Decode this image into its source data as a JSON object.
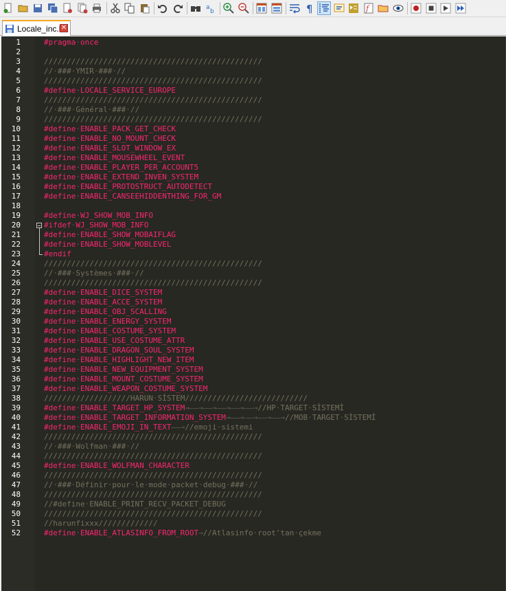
{
  "toolbar": {
    "buttons": [
      {
        "icon": "new-file-icon",
        "color": "#3c8a2e"
      },
      {
        "icon": "open-file-icon",
        "color": "#e0b040"
      },
      {
        "icon": "save-icon",
        "color": "#4a6fb0"
      },
      {
        "icon": "save-all-icon",
        "color": "#4a6fb0"
      },
      {
        "icon": "close-icon",
        "color": "#c04040"
      },
      {
        "icon": "close-all-icon",
        "color": "#c04040"
      },
      {
        "icon": "print-icon",
        "color": "#606060"
      },
      {
        "sep": true
      },
      {
        "icon": "cut-icon",
        "color": "#505050"
      },
      {
        "icon": "copy-icon",
        "color": "#505050"
      },
      {
        "icon": "paste-icon",
        "color": "#8a6a30"
      },
      {
        "sep": true
      },
      {
        "icon": "undo-icon",
        "color": "#404040"
      },
      {
        "icon": "redo-icon",
        "color": "#404040"
      },
      {
        "sep": true
      },
      {
        "icon": "find-icon",
        "color": "#404040"
      },
      {
        "icon": "replace-icon",
        "color": "#2a6fc0"
      },
      {
        "sep": true
      },
      {
        "icon": "zoom-in-icon",
        "color": "#2a8a40"
      },
      {
        "icon": "zoom-out-icon",
        "color": "#c04040"
      },
      {
        "sep": true
      },
      {
        "icon": "sync-vertical-icon",
        "color": "#c05020"
      },
      {
        "icon": "sync-horizontal-icon",
        "color": "#c05020"
      },
      {
        "sep": true
      },
      {
        "icon": "word-wrap-icon",
        "color": "#2a5fb0"
      },
      {
        "icon": "show-all-chars-icon",
        "color": "#2a5fb0"
      },
      {
        "icon": "indent-guide-icon",
        "color": "#2a5fb0",
        "active": true
      },
      {
        "icon": "user-language-icon",
        "color": "#d09030"
      },
      {
        "icon": "document-map-icon",
        "color": "#c0a030"
      },
      {
        "icon": "function-list-icon",
        "color": "#c04040"
      },
      {
        "icon": "folder-workspace-icon",
        "color": "#c04040"
      },
      {
        "icon": "monitoring-icon",
        "color": "#404040"
      },
      {
        "sep": true
      },
      {
        "icon": "record-macro-icon",
        "color": "#c02020"
      },
      {
        "icon": "stop-record-icon",
        "color": "#404040"
      },
      {
        "icon": "playback-macro-icon",
        "color": "#404040"
      },
      {
        "icon": "run-macro-multiple-icon",
        "color": "#2a5fb0"
      }
    ]
  },
  "tab": {
    "label": "Locale_inc.h",
    "close": "✕"
  },
  "colors": {
    "bg": "#272822",
    "keyword": "#f92672",
    "comment": "#75715e",
    "whitespace": "#5f5f56",
    "line_number": "#ffffff"
  },
  "lines": [
    {
      "n": "1",
      "parts": [
        [
          "kw",
          "#pragma"
        ],
        [
          "ws",
          "·"
        ],
        [
          "id",
          "once"
        ]
      ]
    },
    {
      "n": "2",
      "parts": []
    },
    {
      "n": "3",
      "parts": [
        [
          "cm",
          "////////////////////////////////////////////////"
        ]
      ]
    },
    {
      "n": "4",
      "parts": [
        [
          "cm",
          "//"
        ],
        [
          "ws",
          "·"
        ],
        [
          "cm",
          "###"
        ],
        [
          "ws",
          "·"
        ],
        [
          "cm",
          "YMIR"
        ],
        [
          "ws",
          "·"
        ],
        [
          "cm",
          "###"
        ],
        [
          "ws",
          "·"
        ],
        [
          "cm",
          "//"
        ]
      ]
    },
    {
      "n": "5",
      "parts": [
        [
          "cm",
          "////////////////////////////////////////////////"
        ]
      ]
    },
    {
      "n": "6",
      "parts": [
        [
          "kw",
          "#define"
        ],
        [
          "ws",
          "·"
        ],
        [
          "id",
          "LOCALE_SERVICE_EUROPE"
        ]
      ]
    },
    {
      "n": "7",
      "parts": [
        [
          "cm",
          "////////////////////////////////////////////////"
        ]
      ]
    },
    {
      "n": "8",
      "parts": [
        [
          "cm",
          "//"
        ],
        [
          "ws",
          "·"
        ],
        [
          "cm",
          "###"
        ],
        [
          "ws",
          "·"
        ],
        [
          "cm",
          "Général"
        ],
        [
          "ws",
          "·"
        ],
        [
          "cm",
          "###"
        ],
        [
          "ws",
          "·"
        ],
        [
          "cm",
          "//"
        ]
      ]
    },
    {
      "n": "9",
      "parts": [
        [
          "cm",
          "////////////////////////////////////////////////"
        ]
      ]
    },
    {
      "n": "10",
      "parts": [
        [
          "kw",
          "#define"
        ],
        [
          "ws",
          "·"
        ],
        [
          "id",
          "ENABLE_PACK_GET_CHECK"
        ]
      ]
    },
    {
      "n": "11",
      "parts": [
        [
          "kw",
          "#define"
        ],
        [
          "ws",
          "·"
        ],
        [
          "id",
          "ENABLE_NO_MOUNT_CHECK"
        ]
      ]
    },
    {
      "n": "12",
      "parts": [
        [
          "kw",
          "#define"
        ],
        [
          "ws",
          "·"
        ],
        [
          "id",
          "ENABLE_SLOT_WINDOW_EX"
        ]
      ]
    },
    {
      "n": "13",
      "parts": [
        [
          "kw",
          "#define"
        ],
        [
          "ws",
          "·"
        ],
        [
          "id",
          "ENABLE_MOUSEWHEEL_EVENT"
        ]
      ]
    },
    {
      "n": "14",
      "parts": [
        [
          "kw",
          "#define"
        ],
        [
          "ws",
          "·"
        ],
        [
          "id",
          "ENABLE_PLAYER_PER_ACCOUNT5"
        ]
      ]
    },
    {
      "n": "15",
      "parts": [
        [
          "kw",
          "#define"
        ],
        [
          "ws",
          "·"
        ],
        [
          "id",
          "ENABLE_EXTEND_INVEN_SYSTEM"
        ]
      ]
    },
    {
      "n": "16",
      "parts": [
        [
          "kw",
          "#define"
        ],
        [
          "ws",
          "·"
        ],
        [
          "id",
          "ENABLE_PROTOSTRUCT_AUTODETECT"
        ]
      ]
    },
    {
      "n": "17",
      "parts": [
        [
          "kw",
          "#define"
        ],
        [
          "ws",
          "·"
        ],
        [
          "id",
          "ENABLE_CANSEEHIDDENTHING_FOR_GM"
        ]
      ]
    },
    {
      "n": "18",
      "parts": []
    },
    {
      "n": "19",
      "parts": [
        [
          "kw",
          "#define"
        ],
        [
          "ws",
          "·"
        ],
        [
          "id",
          "WJ_SHOW_MOB_INFO"
        ]
      ]
    },
    {
      "n": "20",
      "parts": [
        [
          "kw",
          "#ifdef"
        ],
        [
          "ws",
          "·"
        ],
        [
          "id",
          "WJ_SHOW_MOB_INFO"
        ]
      ],
      "fold": "start"
    },
    {
      "n": "21",
      "parts": [
        [
          "kw",
          "#define"
        ],
        [
          "ws",
          "·"
        ],
        [
          "id",
          "ENABLE_SHOW_MOBAIFLAG"
        ]
      ],
      "fold": "mid"
    },
    {
      "n": "22",
      "parts": [
        [
          "kw",
          "#define"
        ],
        [
          "ws",
          "·"
        ],
        [
          "id",
          "ENABLE_SHOW_MOBLEVEL"
        ]
      ],
      "fold": "mid"
    },
    {
      "n": "23",
      "parts": [
        [
          "kw",
          "#endif"
        ]
      ],
      "fold": "end"
    },
    {
      "n": "24",
      "parts": [
        [
          "cm",
          "////////////////////////////////////////////////"
        ]
      ]
    },
    {
      "n": "25",
      "parts": [
        [
          "cm",
          "//"
        ],
        [
          "ws",
          "·"
        ],
        [
          "cm",
          "###"
        ],
        [
          "ws",
          "·"
        ],
        [
          "cm",
          "Systèmes"
        ],
        [
          "ws",
          "·"
        ],
        [
          "cm",
          "###"
        ],
        [
          "ws",
          "·"
        ],
        [
          "cm",
          "//"
        ]
      ]
    },
    {
      "n": "26",
      "parts": [
        [
          "cm",
          "////////////////////////////////////////////////"
        ]
      ]
    },
    {
      "n": "27",
      "parts": [
        [
          "kw",
          "#define"
        ],
        [
          "ws",
          "·"
        ],
        [
          "id",
          "ENABLE_DICE_SYSTEM"
        ]
      ]
    },
    {
      "n": "28",
      "parts": [
        [
          "kw",
          "#define"
        ],
        [
          "ws",
          "·"
        ],
        [
          "id",
          "ENABLE_ACCE_SYSTEM"
        ]
      ]
    },
    {
      "n": "29",
      "parts": [
        [
          "kw",
          "#define"
        ],
        [
          "ws",
          "·"
        ],
        [
          "id",
          "ENABLE_OBJ_SCALLING"
        ]
      ]
    },
    {
      "n": "30",
      "parts": [
        [
          "kw",
          "#define"
        ],
        [
          "ws",
          "·"
        ],
        [
          "id",
          "ENABLE_ENERGY_SYSTEM"
        ]
      ]
    },
    {
      "n": "31",
      "parts": [
        [
          "kw",
          "#define"
        ],
        [
          "ws",
          "·"
        ],
        [
          "id",
          "ENABLE_COSTUME_SYSTEM"
        ]
      ]
    },
    {
      "n": "32",
      "parts": [
        [
          "kw",
          "#define"
        ],
        [
          "ws",
          "·"
        ],
        [
          "id",
          "ENABLE_USE_COSTUME_ATTR"
        ]
      ]
    },
    {
      "n": "33",
      "parts": [
        [
          "kw",
          "#define"
        ],
        [
          "ws",
          "·"
        ],
        [
          "id",
          "ENABLE_DRAGON_SOUL_SYSTEM"
        ]
      ]
    },
    {
      "n": "34",
      "parts": [
        [
          "kw",
          "#define"
        ],
        [
          "ws",
          "·"
        ],
        [
          "id",
          "ENABLE_HIGHLIGHT_NEW_ITEM"
        ]
      ]
    },
    {
      "n": "35",
      "parts": [
        [
          "kw",
          "#define"
        ],
        [
          "ws",
          "·"
        ],
        [
          "id",
          "ENABLE_NEW_EQUIPMENT_SYSTEM"
        ]
      ]
    },
    {
      "n": "36",
      "parts": [
        [
          "kw",
          "#define"
        ],
        [
          "ws",
          "·"
        ],
        [
          "id",
          "ENABLE_MOUNT_COSTUME_SYSTEM"
        ]
      ]
    },
    {
      "n": "37",
      "parts": [
        [
          "kw",
          "#define"
        ],
        [
          "ws",
          "·"
        ],
        [
          "id",
          "ENABLE_WEAPON_COSTUME_SYSTEM"
        ]
      ]
    },
    {
      "n": "38",
      "parts": [
        [
          "cm",
          "///////////////////HARUN"
        ],
        [
          "ws",
          "·"
        ],
        [
          "cm",
          "SİSTEM///////////////////////////"
        ]
      ]
    },
    {
      "n": "39",
      "parts": [
        [
          "kw",
          "#define"
        ],
        [
          "ws",
          "·"
        ],
        [
          "id",
          "ENABLE_TARGET_HP_SYSTEM"
        ],
        [
          "ws",
          "→——→——→——→——→——→"
        ],
        [
          "cm",
          "//HP"
        ],
        [
          "ws",
          "·"
        ],
        [
          "cm",
          "TARGET"
        ],
        [
          "ws",
          "·"
        ],
        [
          "cm",
          "SİSTEMİ"
        ]
      ]
    },
    {
      "n": "40",
      "parts": [
        [
          "kw",
          "#define"
        ],
        [
          "ws",
          "·"
        ],
        [
          "id",
          "ENABLE_TARGET_INFORMATION_SYSTEM"
        ],
        [
          "ws",
          "→——→——→——→——→"
        ],
        [
          "cm",
          "//MOB"
        ],
        [
          "ws",
          "·"
        ],
        [
          "cm",
          "TARGET"
        ],
        [
          "ws",
          "·"
        ],
        [
          "cm",
          "SİSTEMİ"
        ]
      ]
    },
    {
      "n": "41",
      "parts": [
        [
          "kw",
          "#define"
        ],
        [
          "ws",
          "·"
        ],
        [
          "id",
          "ENABLE_EMOJI_IN_TEXT"
        ],
        [
          "ws",
          "——→"
        ],
        [
          "cm",
          "//emoji"
        ],
        [
          "ws",
          "·"
        ],
        [
          "cm",
          "sistemi"
        ]
      ]
    },
    {
      "n": "42",
      "parts": [
        [
          "cm",
          "////////////////////////////////////////////////"
        ]
      ]
    },
    {
      "n": "43",
      "parts": [
        [
          "cm",
          "//"
        ],
        [
          "ws",
          "·"
        ],
        [
          "cm",
          "###"
        ],
        [
          "ws",
          "·"
        ],
        [
          "cm",
          "Wolfman"
        ],
        [
          "ws",
          "·"
        ],
        [
          "cm",
          "###"
        ],
        [
          "ws",
          "·"
        ],
        [
          "cm",
          "//"
        ]
      ]
    },
    {
      "n": "44",
      "parts": [
        [
          "cm",
          "////////////////////////////////////////////////"
        ]
      ]
    },
    {
      "n": "45",
      "parts": [
        [
          "kw",
          "#define"
        ],
        [
          "ws",
          "·"
        ],
        [
          "id",
          "ENABLE_WOLFMAN_CHARACTER"
        ]
      ]
    },
    {
      "n": "46",
      "parts": [
        [
          "cm",
          "////////////////////////////////////////////////"
        ]
      ]
    },
    {
      "n": "47",
      "parts": [
        [
          "cm",
          "//"
        ],
        [
          "ws",
          "·"
        ],
        [
          "cm",
          "###"
        ],
        [
          "ws",
          "·"
        ],
        [
          "cm",
          "Définir"
        ],
        [
          "ws",
          "·"
        ],
        [
          "cm",
          "pour"
        ],
        [
          "ws",
          "·"
        ],
        [
          "cm",
          "le"
        ],
        [
          "ws",
          "·"
        ],
        [
          "cm",
          "mode"
        ],
        [
          "ws",
          "·"
        ],
        [
          "cm",
          "packet"
        ],
        [
          "ws",
          "·"
        ],
        [
          "cm",
          "debug"
        ],
        [
          "ws",
          "·"
        ],
        [
          "cm",
          "###"
        ],
        [
          "ws",
          "·"
        ],
        [
          "cm",
          "//"
        ]
      ]
    },
    {
      "n": "48",
      "parts": [
        [
          "cm",
          "////////////////////////////////////////////////"
        ]
      ]
    },
    {
      "n": "49",
      "parts": [
        [
          "cm",
          "//#define"
        ],
        [
          "ws",
          "·"
        ],
        [
          "cm",
          "ENABLE_PRINT_RECV_PACKET_DEBUG"
        ]
      ]
    },
    {
      "n": "50",
      "parts": [
        [
          "cm",
          "////////////////////////////////////////////////"
        ]
      ]
    },
    {
      "n": "51",
      "parts": [
        [
          "cm",
          "//harunfixxx/////////////"
        ]
      ]
    },
    {
      "n": "52",
      "parts": [
        [
          "kw",
          "#define"
        ],
        [
          "ws",
          "·"
        ],
        [
          "id",
          "ENABLE_ATLASINFO_FROM_ROOT"
        ],
        [
          "ws",
          "→"
        ],
        [
          "cm",
          "//Atlasinfo"
        ],
        [
          "ws",
          "·"
        ],
        [
          "cm",
          "root'tan"
        ],
        [
          "ws",
          "·"
        ],
        [
          "cm",
          "çekme"
        ]
      ]
    }
  ]
}
